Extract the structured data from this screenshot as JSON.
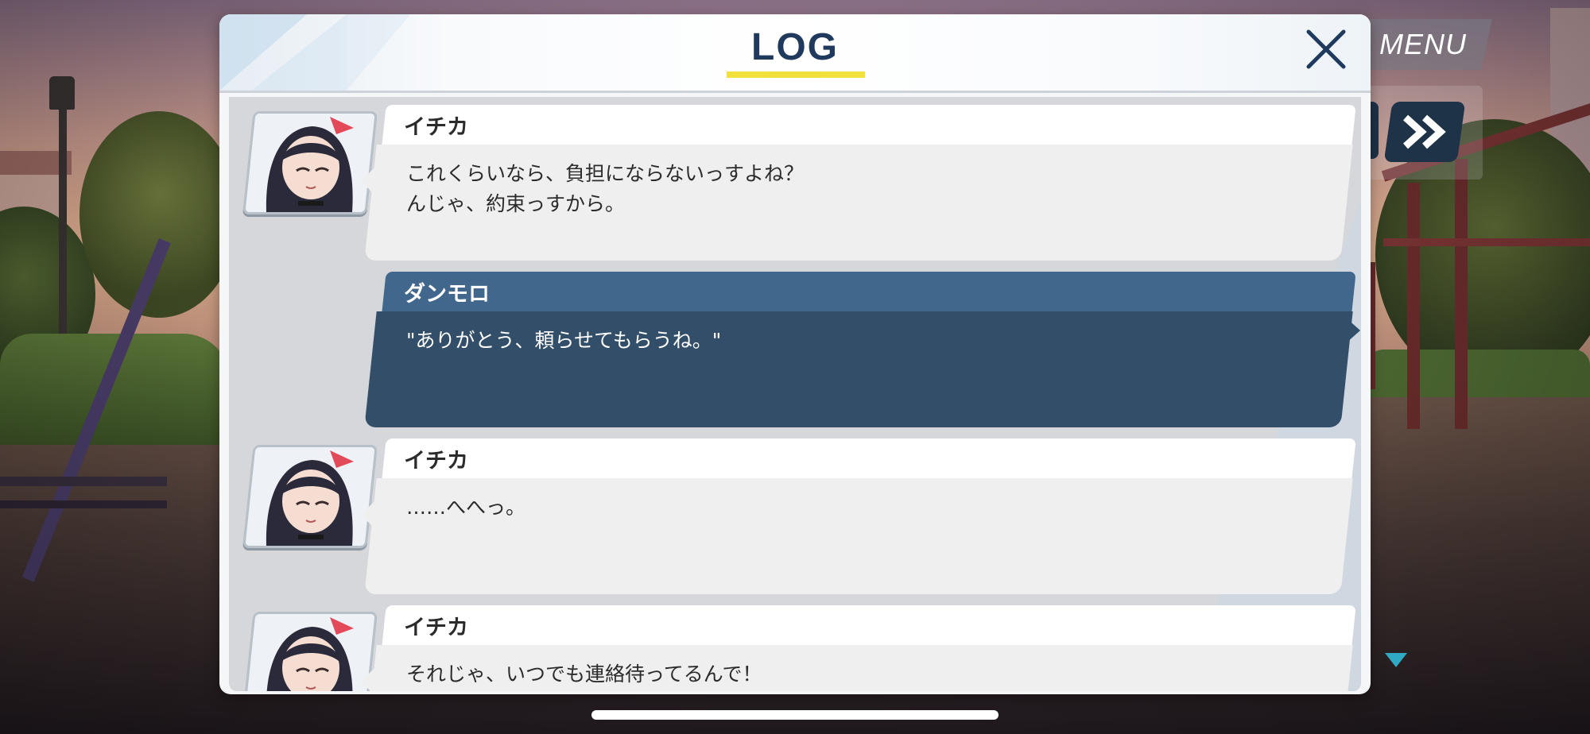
{
  "header": {
    "title": "LOG"
  },
  "hud": {
    "menu_label": "MENU"
  },
  "log": {
    "entries": [
      {
        "speaker": "イチカ",
        "text": "これくらいなら、負担にならないっすよね？\nんじゃ、約束っすから。",
        "type": "npc"
      },
      {
        "speaker": "ダンモロ",
        "text": "\"ありがとう、頼らせてもらうね。\"",
        "type": "player"
      },
      {
        "speaker": "イチカ",
        "text": "……へへっ。",
        "type": "npc"
      },
      {
        "speaker": "イチカ",
        "text": "それじゃ、いつでも連絡待ってるんで！",
        "type": "npc"
      }
    ]
  },
  "colors": {
    "title_accent": "#f2e13a",
    "title_text": "#1f3a5c",
    "player_name_bar": "#41678c",
    "player_bubble": "#334e69",
    "npc_bubble": "#efefef"
  },
  "icons": {
    "close": "close-icon",
    "skip": "fast-forward-icon",
    "scroll": "triangle-down-icon"
  }
}
